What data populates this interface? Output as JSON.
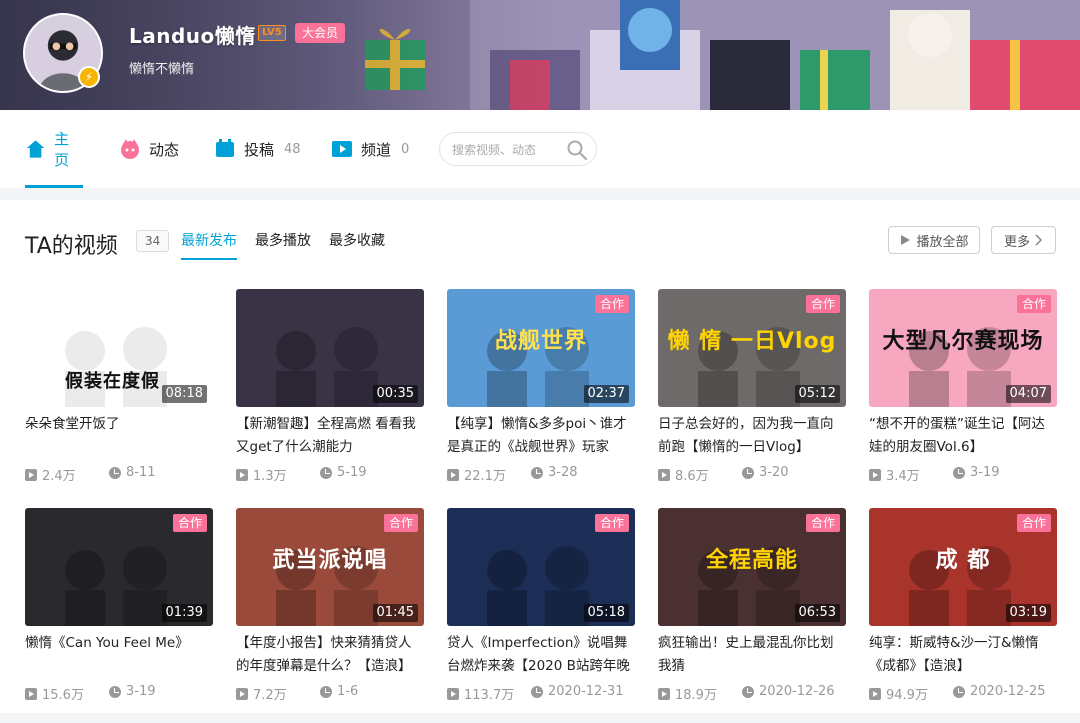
{
  "profile": {
    "name": "Landuo懒惰",
    "level": "LV5",
    "vip": "大会员",
    "sign": "懒惰不懒惰",
    "avatar_badge": "⚡"
  },
  "nav": {
    "tabs": [
      {
        "label": "主页",
        "icon": "home-icon",
        "count": ""
      },
      {
        "label": "动态",
        "icon": "dynamic-icon",
        "count": ""
      },
      {
        "label": "投稿",
        "icon": "upload-icon",
        "count": "48"
      },
      {
        "label": "频道",
        "icon": "channel-icon",
        "count": "0"
      }
    ],
    "search_placeholder": "搜索视频、动态"
  },
  "section": {
    "title": "TA的视频",
    "count": "34",
    "sort": [
      "最新发布",
      "最多播放",
      "最多收藏"
    ],
    "play_all": "播放全部",
    "more": "更多"
  },
  "videos": [
    {
      "title": "朵朵食堂开饭了",
      "duration": "08:18",
      "coop": "",
      "plays": "2.4万",
      "date": "8-11",
      "caption": "假装在度假",
      "bg": "#ffffff",
      "fg": "#111111"
    },
    {
      "title": "【新潮智趣】全程高燃 看看我又get了什么潮能力",
      "duration": "00:35",
      "coop": "",
      "plays": "1.3万",
      "date": "5-19",
      "caption": "",
      "bg": "#3a3346",
      "fg": "#ffffff"
    },
    {
      "title": "【纯享】懒惰&多多poi丶谁才是真正的《战舰世界》玩家",
      "duration": "02:37",
      "coop": "合作",
      "plays": "22.1万",
      "date": "3-28",
      "caption": "战舰世界",
      "bg": "#5a9bd6",
      "fg": "#ffe14d"
    },
    {
      "title": "日子总会好的，因为我一直向前跑【懒惰的一日Vlog】",
      "duration": "05:12",
      "coop": "合作",
      "plays": "8.6万",
      "date": "3-20",
      "caption": "懒 惰  一日Vlog",
      "bg": "#6f6a6a",
      "fg": "#ffd400"
    },
    {
      "title": "“想不开的蛋糕”诞生记【阿达娃的朋友圈Vol.6】",
      "duration": "04:07",
      "coop": "合作",
      "plays": "3.4万",
      "date": "3-19",
      "caption": "大型凡尔赛现场",
      "bg": "#f7a8c0",
      "fg": "#111111"
    },
    {
      "title": "懒惰《Can You Feel Me》",
      "duration": "01:39",
      "coop": "合作",
      "plays": "15.6万",
      "date": "3-19",
      "caption": "",
      "bg": "#2a2a2e",
      "fg": "#ffffff"
    },
    {
      "title": "【年度小报告】快来猜猜贷人的年度弹幕是什么？【造浪】",
      "duration": "01:45",
      "coop": "合作",
      "plays": "7.2万",
      "date": "1-6",
      "caption": "武当派说唱",
      "bg": "#9a4a3a",
      "fg": "#ffffff"
    },
    {
      "title": "贷人《Imperfection》说唱舞台燃炸来袭【2020 B站跨年晚",
      "duration": "05:18",
      "coop": "合作",
      "plays": "113.7万",
      "date": "2020-12-31",
      "caption": "",
      "bg": "#1c2e55",
      "fg": "#ffffff"
    },
    {
      "title": "疯狂输出！史上最混乱你比划我猜",
      "duration": "06:53",
      "coop": "合作",
      "plays": "18.9万",
      "date": "2020-12-26",
      "caption": "全程高能",
      "bg": "#4a3030",
      "fg": "#ffd400"
    },
    {
      "title": "纯享：斯威特&沙一汀&懒惰《成都》【造浪】",
      "duration": "03:19",
      "coop": "合作",
      "plays": "94.9万",
      "date": "2020-12-25",
      "caption": "成 都",
      "bg": "#a8342c",
      "fg": "#ffffff"
    }
  ]
}
